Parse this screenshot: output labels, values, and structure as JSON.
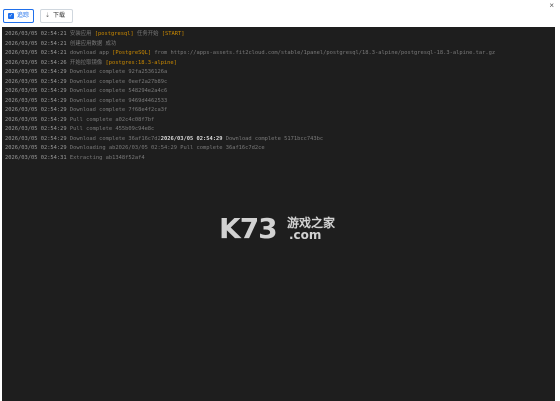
{
  "toolbar": {
    "follow_label": "追踪",
    "download_label": "下载",
    "close_glyph": "×",
    "download_glyph": "⇣"
  },
  "log_lines": [
    {
      "ts": "2026/03/05 02:54:21",
      "parts": [
        {
          "t": "安装应用 "
        },
        {
          "t": "[postgresql]",
          "hl": true
        },
        {
          "t": " 任务开始 "
        },
        {
          "t": "[START]",
          "hl": true
        }
      ]
    },
    {
      "ts": "2026/03/05 02:54:21",
      "parts": [
        {
          "t": "创建应用数据 成功"
        }
      ]
    },
    {
      "ts": "2026/03/05 02:54:21",
      "parts": [
        {
          "t": "download app "
        },
        {
          "t": "[PostgreSQL]",
          "hl": true
        },
        {
          "t": " from https://apps-assets.fit2cloud.com/stable/1panel/postgresql/18.3-alpine/postgresql-18.3-alpine.tar.gz"
        }
      ]
    },
    {
      "ts": "2026/03/05 02:54:26",
      "parts": [
        {
          "t": "开始拉取镜像 "
        },
        {
          "t": "[postgres:18.3-alpine]",
          "hl": true
        }
      ]
    },
    {
      "ts": "2026/03/05 02:54:29",
      "parts": [
        {
          "t": "Download complete 92fa2536126a"
        }
      ]
    },
    {
      "ts": "2026/03/05 02:54:29",
      "parts": [
        {
          "t": "Download complete 0eef2a27b89c"
        }
      ]
    },
    {
      "ts": "2026/03/05 02:54:29",
      "parts": [
        {
          "t": "Download complete 548294e2a4c6"
        }
      ]
    },
    {
      "ts": "2026/03/05 02:54:29",
      "parts": [
        {
          "t": "Download complete 9469d4462533"
        }
      ]
    },
    {
      "ts": "2026/03/05 02:54:29",
      "parts": [
        {
          "t": "Download complete 7f68e4f2ca3f"
        }
      ]
    },
    {
      "ts": "2026/03/05 02:54:29",
      "parts": [
        {
          "t": "Pull complete a02c4c08f7bf"
        }
      ]
    },
    {
      "ts": "2026/03/05 02:54:29",
      "parts": [
        {
          "t": "Pull complete 455b09c94e8c"
        }
      ]
    },
    {
      "ts": "2026/03/05 02:54:29",
      "parts": [
        {
          "t": "Download complete 36af16c7d2"
        },
        {
          "t": "2026/03/05 02:54:29",
          "bold": true
        },
        {
          "t": " Download complete 5171bcc743bc"
        }
      ]
    },
    {
      "ts": "2026/03/05 02:54:29",
      "parts": [
        {
          "t": "Downloading ab2026/03/05 02:54:29 Pull complete 36af16c7d2ce"
        }
      ]
    },
    {
      "ts": "2026/03/05 02:54:31",
      "parts": [
        {
          "t": "Extracting ab1348f52af4"
        }
      ]
    }
  ],
  "watermark": {
    "logo": "K73",
    "cn": "游戏之家",
    "domain": ".com"
  }
}
